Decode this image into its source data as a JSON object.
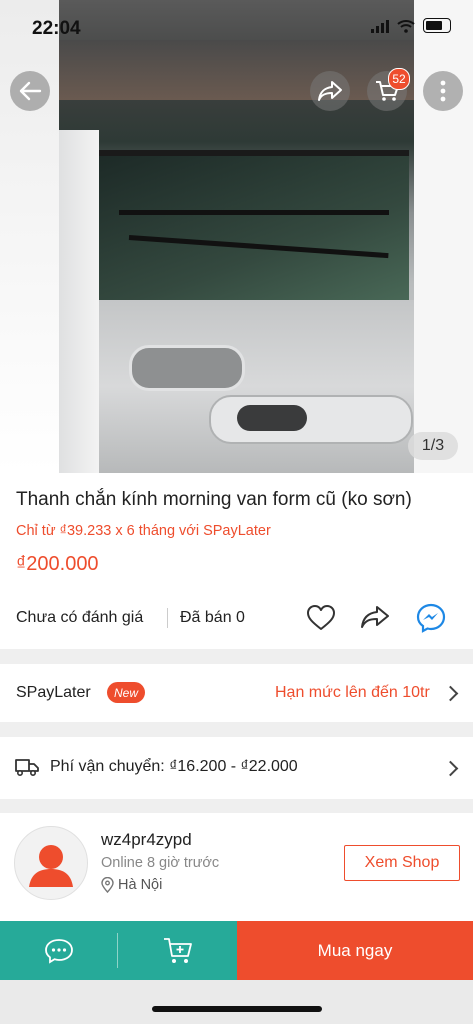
{
  "status": {
    "time": "22:04"
  },
  "hero": {
    "cart_count": "52",
    "page_indicator": "1/3"
  },
  "product": {
    "title": "Thanh chắn kính morning van form cũ (ko sơn)",
    "spaylater_promo": "Chỉ từ ₫39.233 x 6 tháng với SPayLater",
    "price": "₫200.000",
    "rating": "Chưa có đánh giá",
    "sold": "Đã bán 0"
  },
  "spaylater": {
    "label": "SPayLater",
    "badge": "New",
    "limit": "Hạn mức lên đến 10tr"
  },
  "shipping": {
    "text": "Phí vận chuyển: ₫16.200 - ₫22.000"
  },
  "shop": {
    "name": "wz4pr4zypd",
    "online": "Online 8 giờ trước",
    "location": "Hà Nội",
    "view_button": "Xem Shop"
  },
  "bottom_bar": {
    "buy_now": "Mua ngay"
  },
  "colors": {
    "accent": "#ee4d2d",
    "teal": "#26aa99"
  },
  "icons": [
    "back-arrow-icon",
    "share-icon",
    "cart-icon",
    "more-icon",
    "heart-icon",
    "messenger-icon",
    "truck-icon",
    "location-pin-icon",
    "chat-icon",
    "add-to-cart-icon",
    "chevron-right-icon"
  ]
}
